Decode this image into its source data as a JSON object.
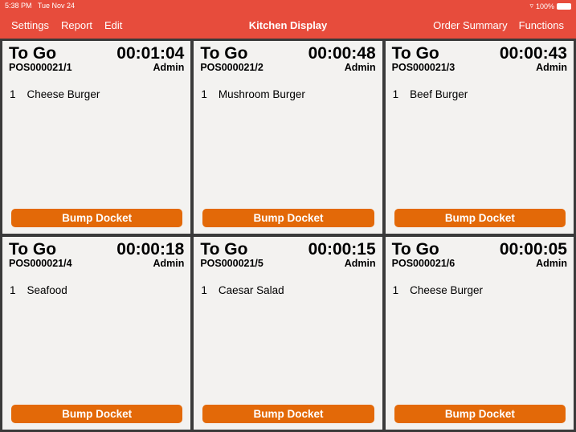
{
  "status_bar": {
    "time": "5:38 PM",
    "date": "Tue Nov 24",
    "battery": "100%"
  },
  "nav": {
    "left": [
      "Settings",
      "Report",
      "Edit"
    ],
    "title": "Kitchen Display",
    "right": [
      "Order Summary",
      "Functions"
    ]
  },
  "dockets": [
    {
      "type": "To Go",
      "timer": "00:01:04",
      "order": "POS000021/1",
      "user": "Admin",
      "items": [
        {
          "qty": "1",
          "name": "Cheese Burger"
        }
      ],
      "button": "Bump Docket"
    },
    {
      "type": "To Go",
      "timer": "00:00:48",
      "order": "POS000021/2",
      "user": "Admin",
      "items": [
        {
          "qty": "1",
          "name": "Mushroom Burger"
        }
      ],
      "button": "Bump Docket"
    },
    {
      "type": "To Go",
      "timer": "00:00:43",
      "order": "POS000021/3",
      "user": "Admin",
      "items": [
        {
          "qty": "1",
          "name": "Beef Burger"
        }
      ],
      "button": "Bump Docket"
    },
    {
      "type": "To Go",
      "timer": "00:00:18",
      "order": "POS000021/4",
      "user": "Admin",
      "items": [
        {
          "qty": "1",
          "name": "Seafood"
        }
      ],
      "button": "Bump Docket"
    },
    {
      "type": "To Go",
      "timer": "00:00:15",
      "order": "POS000021/5",
      "user": "Admin",
      "items": [
        {
          "qty": "1",
          "name": "Caesar Salad"
        }
      ],
      "button": "Bump Docket"
    },
    {
      "type": "To Go",
      "timer": "00:00:05",
      "order": "POS000021/6",
      "user": "Admin",
      "items": [
        {
          "qty": "1",
          "name": "Cheese Burger"
        }
      ],
      "button": "Bump Docket"
    }
  ]
}
